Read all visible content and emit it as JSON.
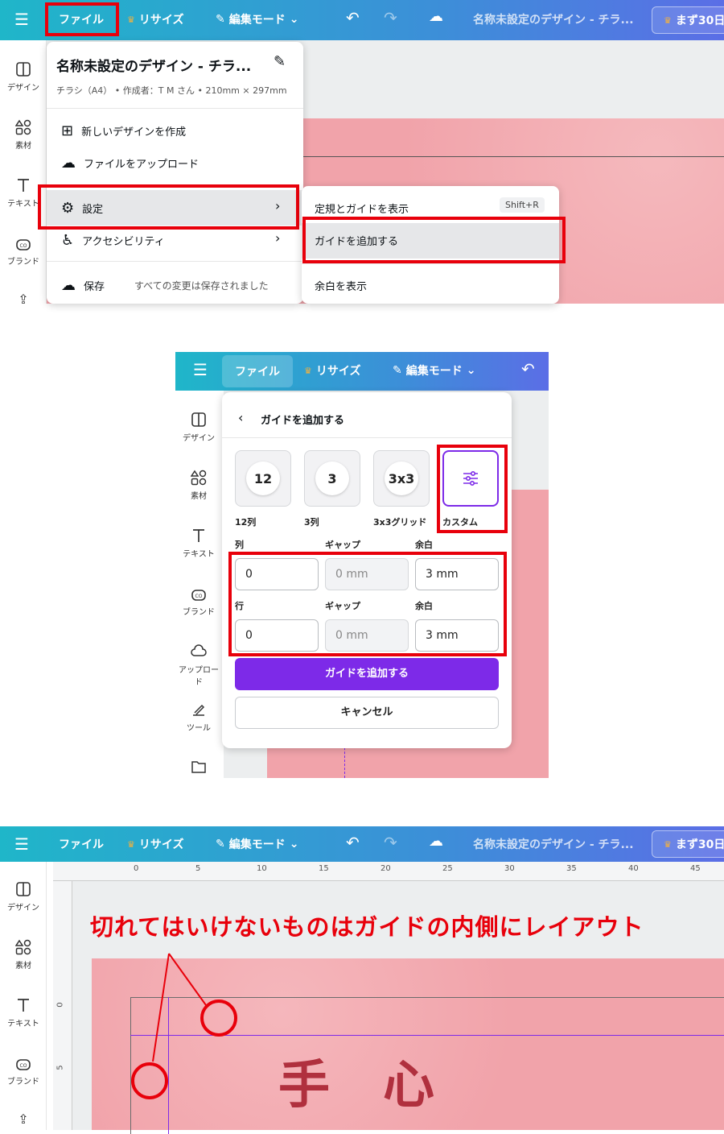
{
  "top": {
    "file": "ファイル",
    "resize": "リサイズ",
    "edit_mode": "編集モード",
    "doc_title": "名称未設定のデザイン - チラ...",
    "trial": "まず30日"
  },
  "sidebar": [
    "デザイン",
    "素材",
    "テキスト",
    "ブランド",
    "アップロード",
    "ツール"
  ],
  "file_menu": {
    "title": "名称未設定のデザイン - チラ...",
    "meta": "チラシ（A4） • 作成者：T M さん • 210mm × 297mm",
    "items": [
      "新しいデザインを作成",
      "ファイルをアップロード",
      "設定",
      "アクセシビリティ",
      "保存"
    ],
    "save_status": "すべての変更は保存されました"
  },
  "settings_menu": {
    "items": [
      "定規とガイドを表示",
      "ガイドを追加する",
      "余白を表示"
    ],
    "shortcut": "Shift+R"
  },
  "guide_panel": {
    "title": "ガイドを追加する",
    "presets": [
      {
        "value": "12",
        "label": "12列"
      },
      {
        "value": "3",
        "label": "3列"
      },
      {
        "value": "3x3",
        "label": "3x3グリッド"
      },
      {
        "value": "",
        "label": "カスタム"
      }
    ],
    "col_label": "列",
    "gap_label": "ギャップ",
    "margin_label": "余白",
    "row_label": "行",
    "col_value": "0",
    "col_gap": "0 mm",
    "col_margin": "3 mm",
    "row_value": "0",
    "row_gap": "0 mm",
    "row_margin": "3 mm",
    "add_button": "ガイドを追加する",
    "cancel_button": "キャンセル"
  },
  "ruler": {
    "h": [
      "0",
      "5",
      "10",
      "15",
      "20",
      "25",
      "30",
      "35",
      "40",
      "45"
    ],
    "v": [
      "0",
      "5"
    ]
  },
  "annotation": "切れてはいけないものはガイドの内側にレイアウト",
  "canvas_text": [
    "手",
    "心"
  ],
  "colors": {
    "accent": "#7d2ae8",
    "highlight": "#e8000b"
  }
}
